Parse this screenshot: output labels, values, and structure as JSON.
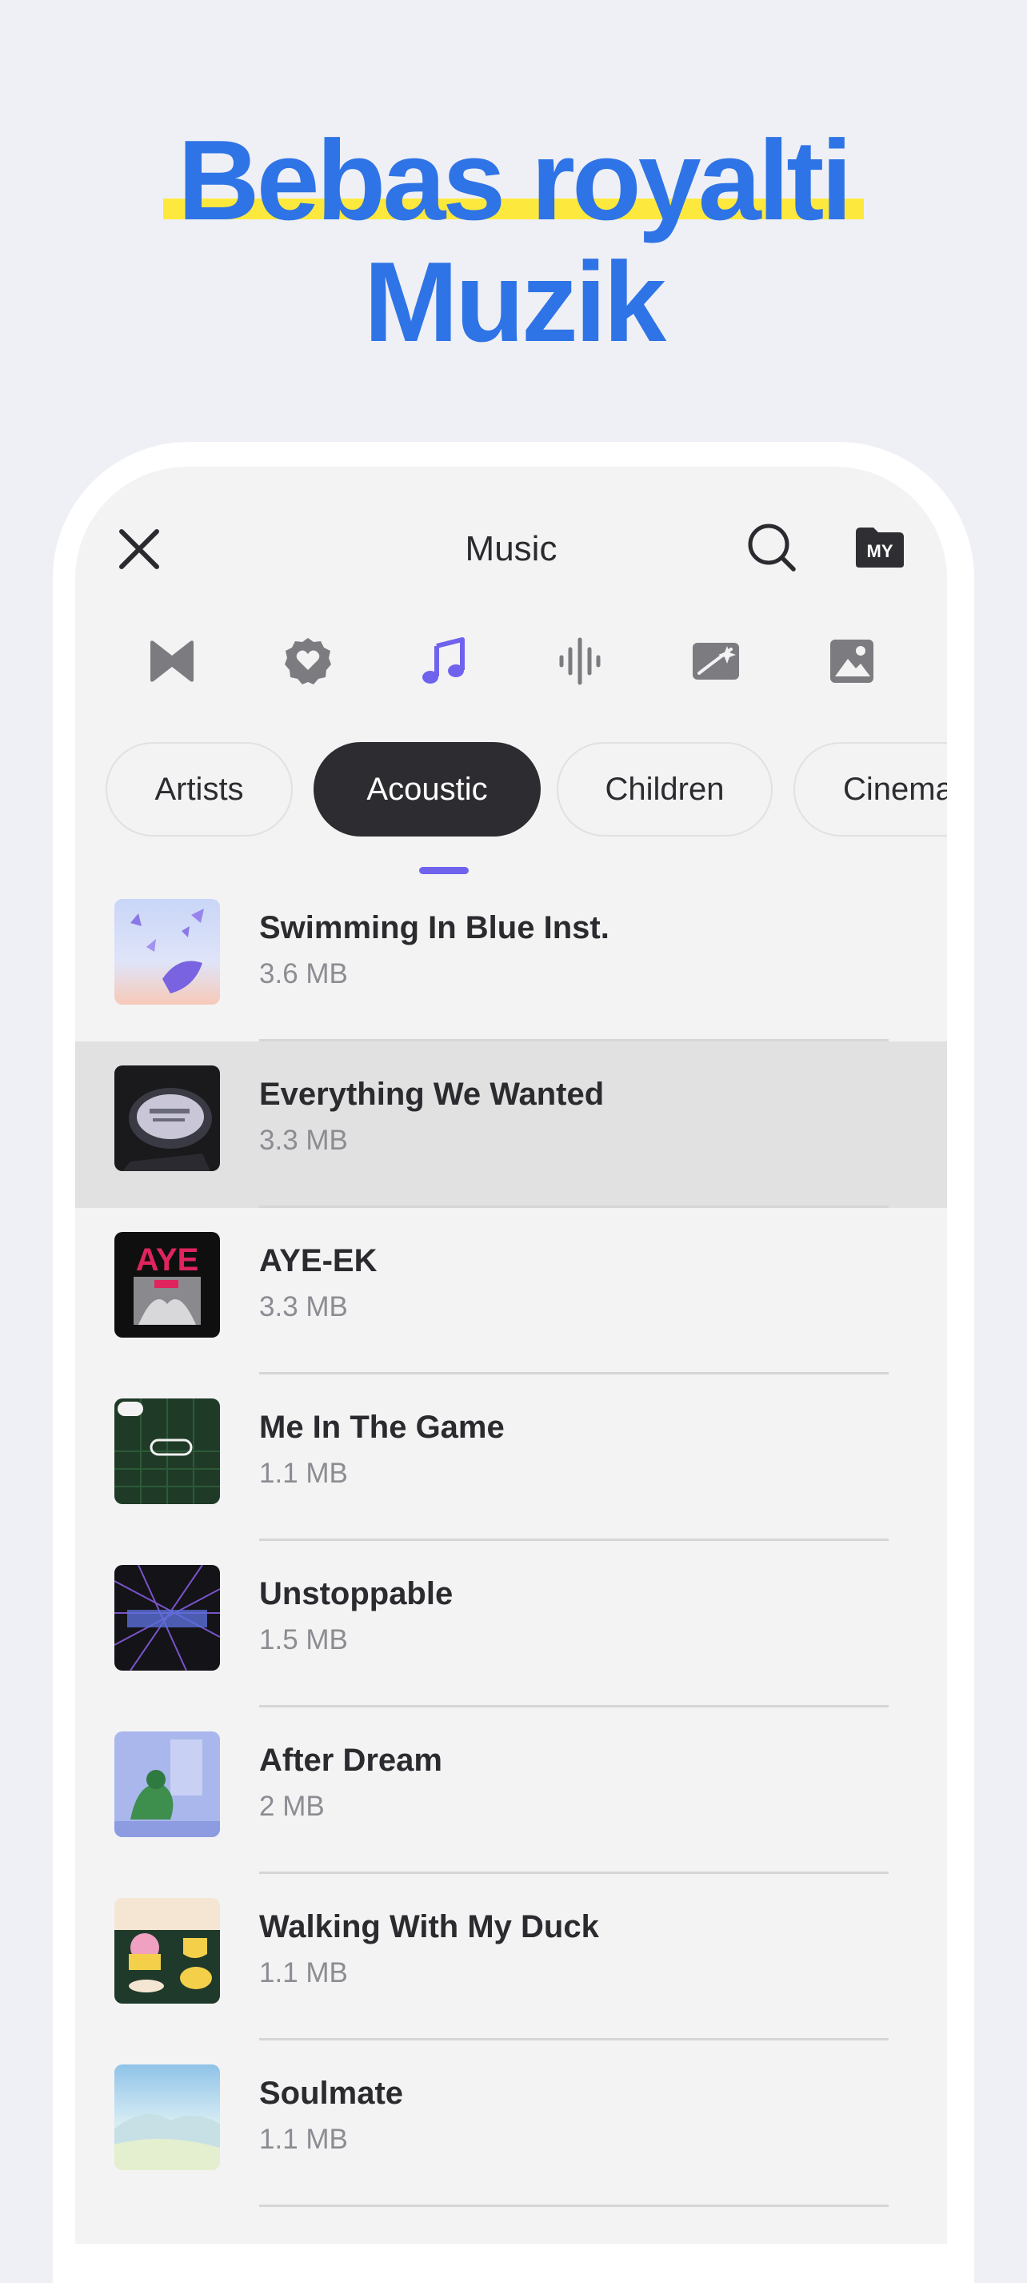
{
  "headline": {
    "line1": "Bebas royalti",
    "line2": "Muzik"
  },
  "topbar": {
    "title": "Music",
    "close_icon": "close-icon",
    "search_icon": "search-icon",
    "my_label": "MY"
  },
  "tabs": [
    {
      "name": "bowtie-icon",
      "active": false
    },
    {
      "name": "heart-badge-icon",
      "active": false
    },
    {
      "name": "music-note-icon",
      "active": true
    },
    {
      "name": "soundwave-icon",
      "active": false
    },
    {
      "name": "sparkle-image-icon",
      "active": false
    },
    {
      "name": "image-icon",
      "active": false
    }
  ],
  "chips": [
    {
      "label": "Artists",
      "active": false
    },
    {
      "label": "Acoustic",
      "active": true
    },
    {
      "label": "Children",
      "active": false
    },
    {
      "label": "Cinema",
      "active": false
    }
  ],
  "tracks": [
    {
      "title": "Swimming In Blue Inst.",
      "size": "3.6 MB",
      "selected": false
    },
    {
      "title": "Everything We Wanted",
      "size": "3.3 MB",
      "selected": true
    },
    {
      "title": "AYE-EK",
      "size": "3.3 MB",
      "selected": false
    },
    {
      "title": "Me In The Game",
      "size": "1.1 MB",
      "selected": false
    },
    {
      "title": "Unstoppable",
      "size": "1.5 MB",
      "selected": false
    },
    {
      "title": "After Dream",
      "size": "2 MB",
      "selected": false
    },
    {
      "title": "Walking With My Duck",
      "size": "1.1 MB",
      "selected": false
    },
    {
      "title": "Soulmate",
      "size": "1.1 MB",
      "selected": false
    }
  ],
  "colors": {
    "accent": "#6f63ee",
    "headline": "#2f74e6",
    "highlight": "#fde93d"
  }
}
